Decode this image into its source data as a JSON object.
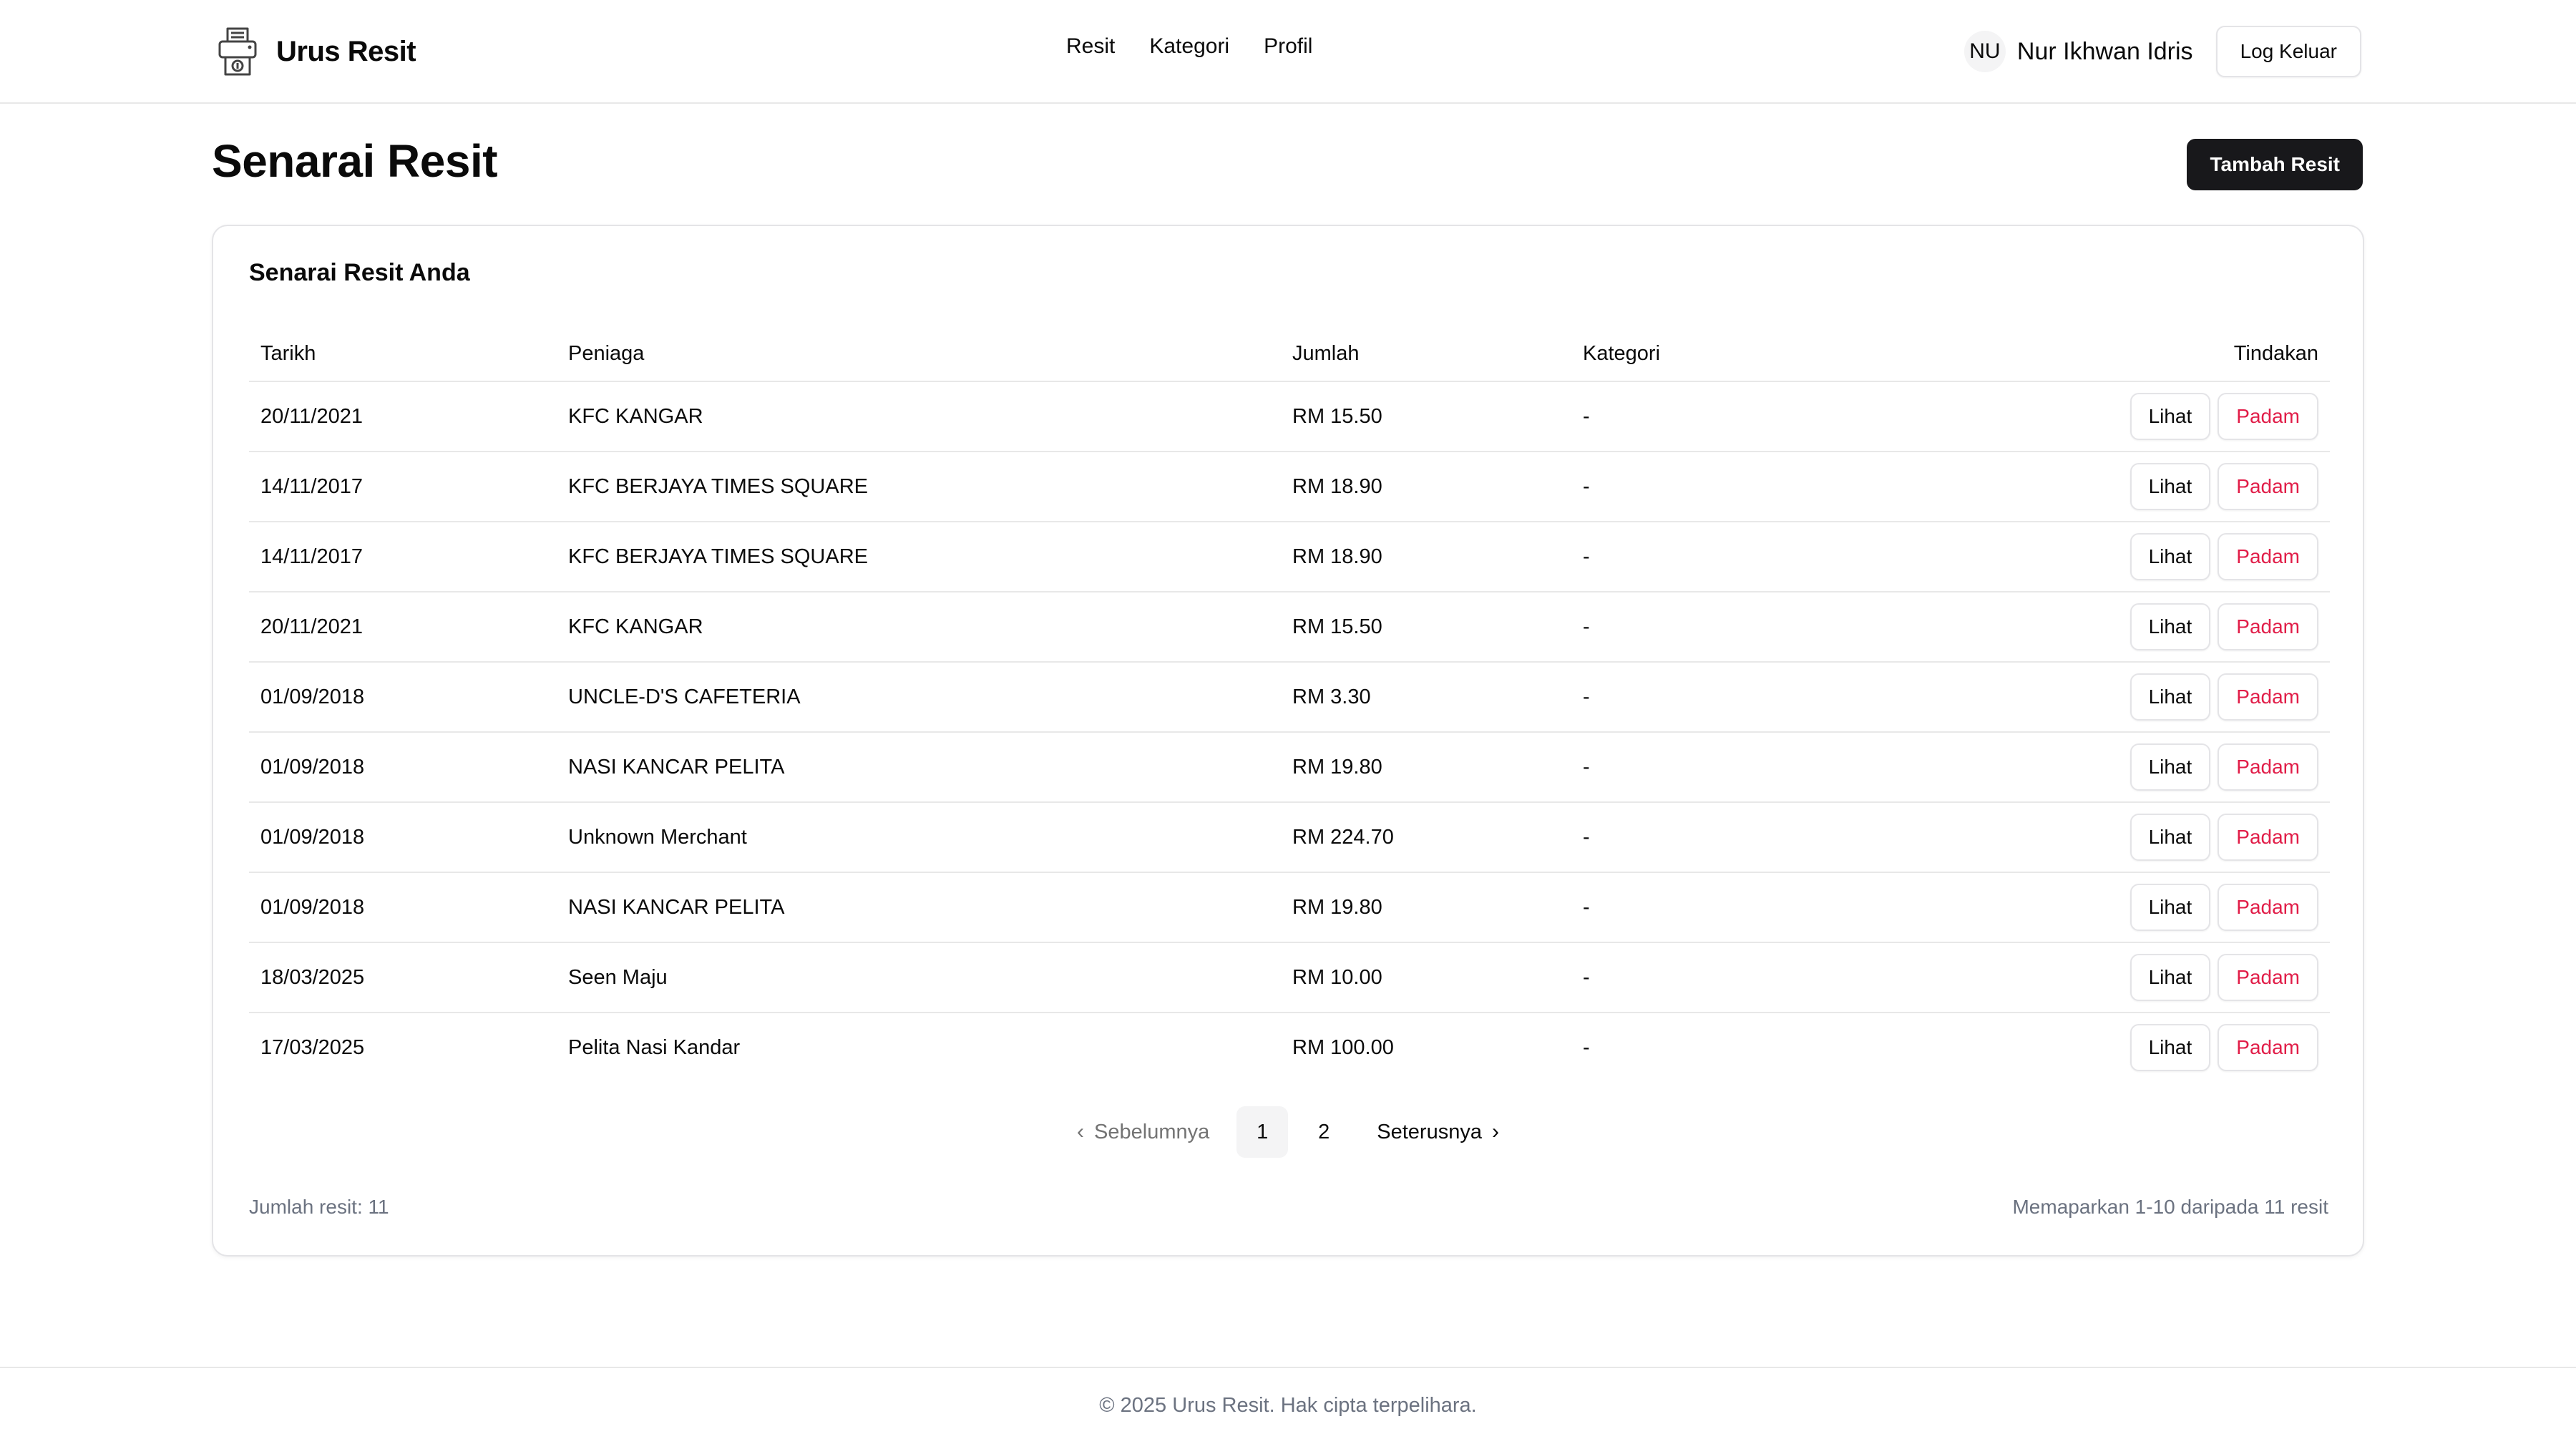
{
  "header": {
    "app_name": "Urus Resit",
    "logo_icon": "receipt-printer-icon",
    "nav": [
      "Resit",
      "Kategori",
      "Profil"
    ],
    "user_initials": "NU",
    "user_name": "Nur Ikhwan Idris",
    "logout_label": "Log Keluar"
  },
  "page": {
    "title": "Senarai Resit",
    "add_button": "Tambah Resit"
  },
  "card": {
    "title": "Senarai Resit Anda",
    "columns": [
      "Tarikh",
      "Peniaga",
      "Jumlah",
      "Kategori",
      "Tindakan"
    ],
    "rows": [
      {
        "date": "20/11/2021",
        "merchant": "KFC KANGAR",
        "amount": "RM 15.50",
        "category": "-"
      },
      {
        "date": "14/11/2017",
        "merchant": "KFC BERJAYA TIMES SQUARE",
        "amount": "RM 18.90",
        "category": "-"
      },
      {
        "date": "14/11/2017",
        "merchant": "KFC BERJAYA TIMES SQUARE",
        "amount": "RM 18.90",
        "category": "-"
      },
      {
        "date": "20/11/2021",
        "merchant": "KFC KANGAR",
        "amount": "RM 15.50",
        "category": "-"
      },
      {
        "date": "01/09/2018",
        "merchant": "UNCLE-D'S CAFETERIA",
        "amount": "RM 3.30",
        "category": "-"
      },
      {
        "date": "01/09/2018",
        "merchant": "NASI KANCAR PELITA",
        "amount": "RM 19.80",
        "category": "-"
      },
      {
        "date": "01/09/2018",
        "merchant": "Unknown Merchant",
        "amount": "RM 224.70",
        "category": "-"
      },
      {
        "date": "01/09/2018",
        "merchant": "NASI KANCAR PELITA",
        "amount": "RM 19.80",
        "category": "-"
      },
      {
        "date": "18/03/2025",
        "merchant": "Seen Maju",
        "amount": "RM 10.00",
        "category": "-"
      },
      {
        "date": "17/03/2025",
        "merchant": "Pelita Nasi Kandar",
        "amount": "RM 100.00",
        "category": "-"
      }
    ],
    "view_label": "Lihat",
    "delete_label": "Padam",
    "pagination": {
      "prev_label": "Sebelumnya",
      "next_label": "Seterusnya",
      "pages": [
        "1",
        "2"
      ],
      "current": "1"
    },
    "total_label": "Jumlah resit: 11",
    "showing_label": "Memaparkan 1-10 daripada 11 resit"
  },
  "footer": {
    "copyright": "© 2025 Urus Resit. Hak cipta terpelihara."
  },
  "colors": {
    "accent": "#18181b",
    "danger": "#e11d48",
    "muted": "#6b7280",
    "border": "#e4e4e7"
  }
}
